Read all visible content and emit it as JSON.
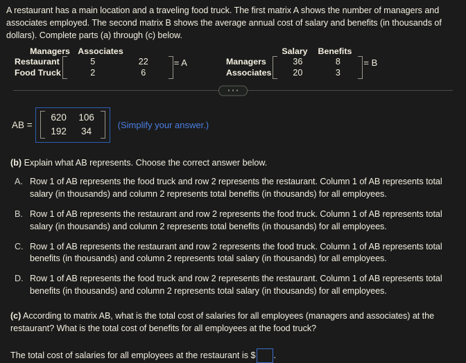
{
  "intro": "A restaurant has a main location and a traveling food truck. The first matrix A shows the number of managers and associates employed. The second matrix B shows the average annual cost of salary and benefits (in thousands of dollars). Complete parts (a) through (c) below.",
  "matrix_a": {
    "col_headers": [
      "Managers",
      "Associates"
    ],
    "row_labels": [
      "Restaurant",
      "Food Truck"
    ],
    "values": [
      [
        "5",
        "22"
      ],
      [
        "2",
        "6"
      ]
    ],
    "name_label": "= A"
  },
  "matrix_b": {
    "col_headers": [
      "Salary",
      "Benefits"
    ],
    "row_labels": [
      "Managers",
      "Associates"
    ],
    "values": [
      [
        "36",
        "8"
      ],
      [
        "20",
        "3"
      ]
    ],
    "name_label": "= B"
  },
  "answer_a": {
    "equals_label": "AB =",
    "values": [
      [
        "620",
        "106"
      ],
      [
        "192",
        "34"
      ]
    ],
    "hint": "(Simplify your answer.)"
  },
  "part_b": {
    "prompt_label": "(b)",
    "prompt_text": " Explain what AB represents. Choose the correct answer below.",
    "options": [
      {
        "letter": "A.",
        "text": "Row 1 of AB represents the food truck and row 2 represents the restaurant. Column 1 of AB represents total salary (in thousands) and column 2 represents total benefits (in thousands) for all employees."
      },
      {
        "letter": "B.",
        "text": "Row 1 of AB represents the restaurant and row 2 represents the food truck. Column 1 of AB represents total salary (in thousands) and column 2 represents total benefits (in thousands) for all employees."
      },
      {
        "letter": "C.",
        "text": "Row 1 of AB represents the restaurant and row 2 represents the food truck. Column 1 of AB represents total benefits (in thousands) and column 2 represents total salary (in thousands) for all employees."
      },
      {
        "letter": "D.",
        "text": "Row 1 of AB represents the food truck and row 2 represents the restaurant. Column 1 of AB represents total benefits (in thousands) and column 2 represents total salary (in thousands) for all employees."
      }
    ]
  },
  "part_c": {
    "prompt_label": "(c)",
    "prompt_text": " According to matrix AB, what is the total cost of salaries for all employees (managers and associates) at the restaurant? What is the total cost of benefits for all employees at the food truck?",
    "answer_prefix": "The total cost of salaries for all employees at the restaurant is $",
    "answer_value": "",
    "answer_suffix": "."
  },
  "colors": {
    "background": "#1b1b1b",
    "text": "#f3efe0",
    "accent_blue": "#4a7fe3",
    "input_border": "#3d6fcc",
    "bracket": "#9a968c",
    "divider": "#4a4a46"
  }
}
